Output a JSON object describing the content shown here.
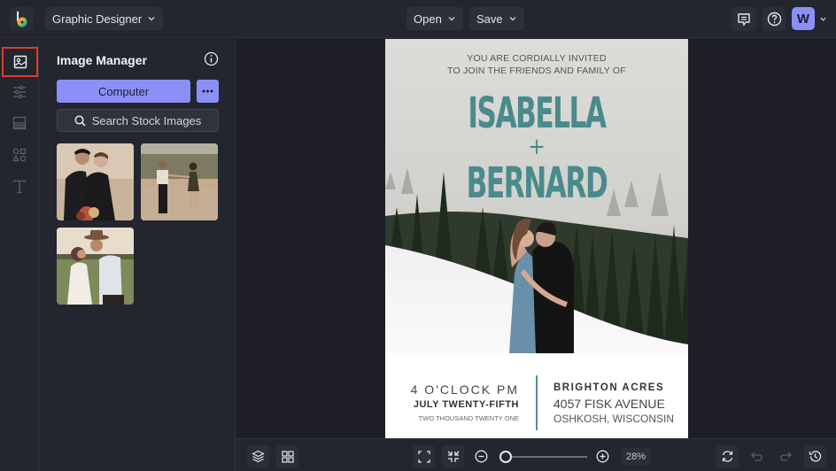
{
  "topbar": {
    "logo": "befunky-logo-icon",
    "mode_selector": "Graphic Designer",
    "open_label": "Open",
    "save_label": "Save",
    "comments_icon": "comment-icon",
    "help_icon": "help-icon",
    "avatar_initial": "W"
  },
  "rail": {
    "items": [
      {
        "name": "image-manager",
        "icon": "image-icon",
        "active": true
      },
      {
        "name": "customize",
        "icon": "sliders-icon",
        "active": false
      },
      {
        "name": "layouts",
        "icon": "layout-icon",
        "active": false
      },
      {
        "name": "graphics",
        "icon": "shapes-icon",
        "active": false
      },
      {
        "name": "text",
        "icon": "text-icon",
        "active": false
      }
    ]
  },
  "panel": {
    "title": "Image Manager",
    "computer_label": "Computer",
    "more_label": "•••",
    "search_label": "Search Stock Images",
    "thumbnails": [
      {
        "description": "Couple in black formal wear with bouquet"
      },
      {
        "description": "Couple holding hands walking on path"
      },
      {
        "description": "Couple kissing, man in hat"
      }
    ]
  },
  "card": {
    "invite_line1": "YOU ARE CORDIALLY INVITED",
    "invite_line2": "TO JOIN THE FRIENDS AND FAMILY OF",
    "name1": "ISABELLA",
    "plus": "+",
    "name2": "BERNARD",
    "time": "4 O'CLOCK PM",
    "date": "JULY TWENTY-FIFTH",
    "year": "TWO THOUSAND TWENTY ONE",
    "venue": "BRIGHTON ACRES",
    "street": "4057 FISK AVENUE",
    "city": "OSHKOSH, WISCONSIN",
    "accent_color": "#4a8a8c"
  },
  "bottombar": {
    "zoom_level": "28%",
    "zoom_fraction": 0.05
  },
  "colors": {
    "accent": "#8c8ff6",
    "highlight": "#e23a2a",
    "background": "#1d1e27",
    "panel": "#23252f"
  }
}
